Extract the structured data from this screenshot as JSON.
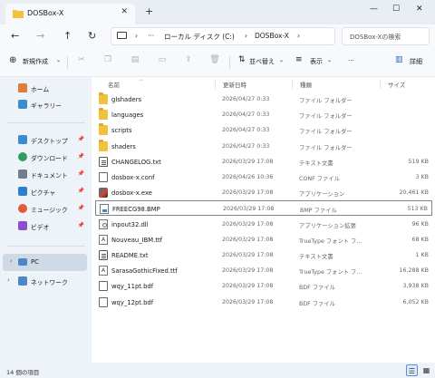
{
  "window": {
    "tab_title": "DOSBox-X"
  },
  "nav": {
    "breadcrumb": [
      "ローカル ディスク (C:)",
      "DOSBox-X"
    ],
    "search_placeholder": "DOSBox-Xの検索"
  },
  "toolbar": {
    "new_label": "新規作成",
    "sort_label": "並べ替え",
    "view_label": "表示",
    "details_label": "詳細"
  },
  "sidebar": {
    "home": "ホーム",
    "gallery": "ギャラリー",
    "quick": [
      "デスクトップ",
      "ダウンロード",
      "ドキュメント",
      "ピクチャ",
      "ミュージック",
      "ビデオ"
    ],
    "pc": "PC",
    "network": "ネットワーク"
  },
  "columns": {
    "name": "名前",
    "date": "更新日時",
    "type": "種類",
    "size": "サイズ"
  },
  "files": [
    {
      "name": "glshaders",
      "date": "2026/04/27 0:33",
      "type": "ファイル フォルダー",
      "size": "",
      "icon": "folder-icon"
    },
    {
      "name": "languages",
      "date": "2026/04/27 0:33",
      "type": "ファイル フォルダー",
      "size": "",
      "icon": "folder-icon"
    },
    {
      "name": "scripts",
      "date": "2026/04/27 0:33",
      "type": "ファイル フォルダー",
      "size": "",
      "icon": "folder-icon"
    },
    {
      "name": "shaders",
      "date": "2026/04/27 0:33",
      "type": "ファイル フォルダー",
      "size": "",
      "icon": "folder-icon"
    },
    {
      "name": "CHANGELOG.txt",
      "date": "2026/03/29 17:08",
      "type": "テキスト文書",
      "size": "519 KB",
      "icon": "text-file-icon"
    },
    {
      "name": "dosbox-x.conf",
      "date": "2026/04/26 10:36",
      "type": "CONF ファイル",
      "size": "3 KB",
      "icon": "file-icon"
    },
    {
      "name": "dosbox-x.exe",
      "date": "2026/03/29 17:08",
      "type": "アプリケーション",
      "size": "20,461 KB",
      "icon": "exe-icon"
    },
    {
      "name": "FREECG98.BMP",
      "date": "2026/03/29 17:08",
      "type": "BMP ファイル",
      "size": "513 KB",
      "icon": "bmp-icon"
    },
    {
      "name": "inpout32.dll",
      "date": "2026/03/29 17:08",
      "type": "アプリケーション拡張",
      "size": "96 KB",
      "icon": "dll-icon"
    },
    {
      "name": "Nouveau_IBM.ttf",
      "date": "2026/03/29 17:08",
      "type": "TrueType フォント フ...",
      "size": "68 KB",
      "icon": "font-icon"
    },
    {
      "name": "README.txt",
      "date": "2026/03/29 17:08",
      "type": "テキスト文書",
      "size": "1 KB",
      "icon": "text-file-icon"
    },
    {
      "name": "SarasaGothicFixed.ttf",
      "date": "2026/03/29 17:08",
      "type": "TrueType フォント フ...",
      "size": "16,288 KB",
      "icon": "font-icon"
    },
    {
      "name": "wqy_11pt.bdf",
      "date": "2026/03/29 17:08",
      "type": "BDF ファイル",
      "size": "3,938 KB",
      "icon": "file-icon"
    },
    {
      "name": "wqy_12pt.bdf",
      "date": "2026/03/29 17:08",
      "type": "BDF ファイル",
      "size": "6,052 KB",
      "icon": "file-icon"
    }
  ],
  "selected_index": 7,
  "status": {
    "count": "14 個の項目"
  }
}
